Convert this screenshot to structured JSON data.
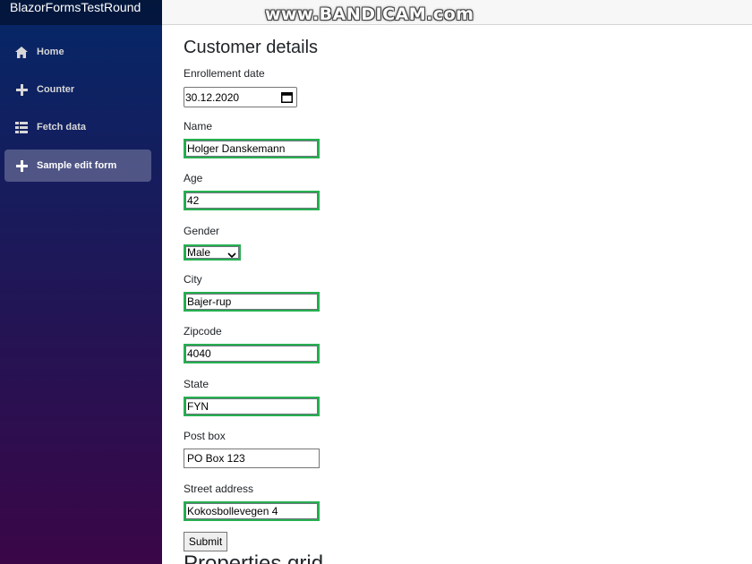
{
  "app": {
    "brand": "BlazorFormsTestRound",
    "watermark": "www.BANDICAM.com"
  },
  "sidebar": {
    "items": [
      {
        "label": "Home",
        "icon": "home-icon",
        "active": false
      },
      {
        "label": "Counter",
        "icon": "plus-icon",
        "active": false
      },
      {
        "label": "Fetch data",
        "icon": "list-icon",
        "active": false
      },
      {
        "label": "Sample edit form",
        "icon": "plus-icon",
        "active": true
      }
    ]
  },
  "form": {
    "title": "Customer details",
    "enrollment_date": {
      "label": "Enrollement date",
      "value": "30.12.2020"
    },
    "name": {
      "label": "Name",
      "value": "Holger Danskemann"
    },
    "age": {
      "label": "Age",
      "value": "42"
    },
    "gender": {
      "label": "Gender",
      "value": "Male"
    },
    "city": {
      "label": "City",
      "value": "Bajer-rup"
    },
    "zipcode": {
      "label": "Zipcode",
      "value": "4040"
    },
    "state": {
      "label": "State",
      "value": "FYN"
    },
    "post_box": {
      "label": "Post box",
      "value": "PO Box 123"
    },
    "street_address": {
      "label": "Street address",
      "value": "Kokosbollevegen 4"
    },
    "submit_label": "Submit"
  },
  "next_section": {
    "title": "Properties grid"
  },
  "colors": {
    "valid_border": "#26b050",
    "sidebar_top": "#052767",
    "sidebar_bottom": "#3a0647"
  }
}
